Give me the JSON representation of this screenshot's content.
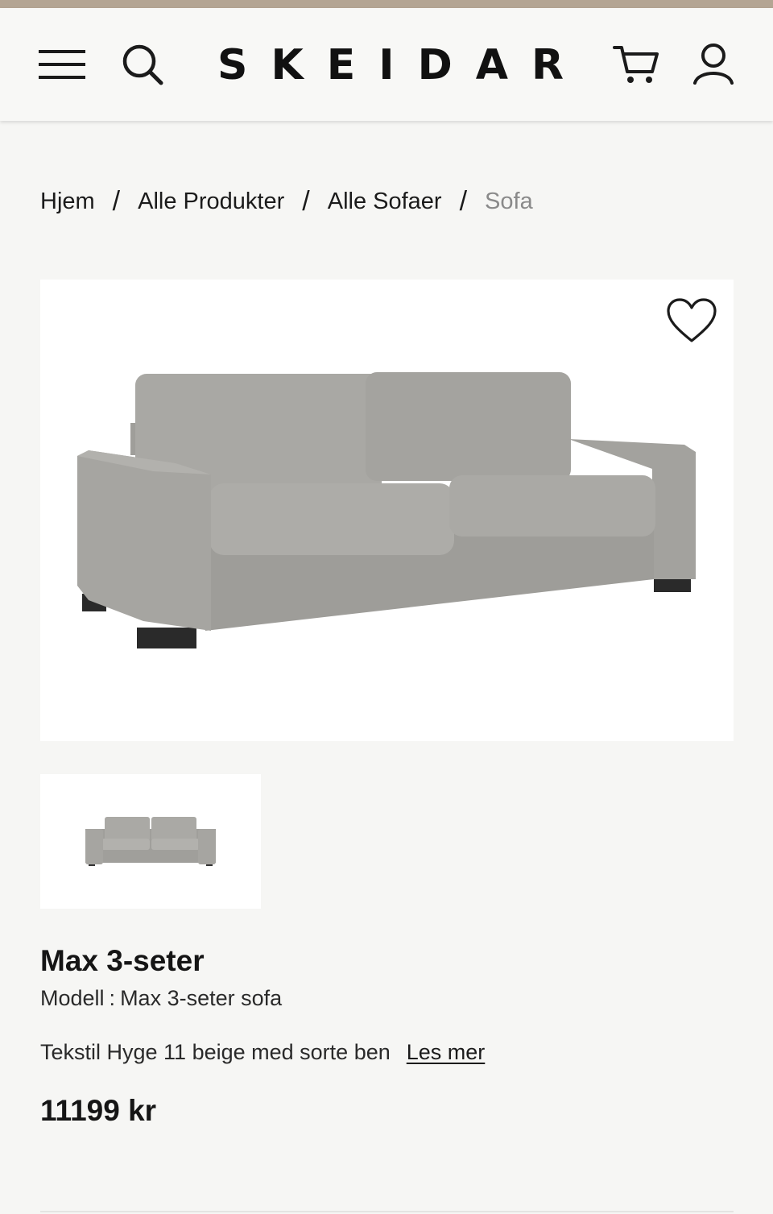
{
  "header": {
    "brand": "SKEIDAR",
    "menu_icon": "hamburger-menu-icon",
    "search_icon": "search-icon",
    "cart_icon": "cart-icon",
    "account_icon": "user-icon"
  },
  "breadcrumb": [
    {
      "label": "Hjem"
    },
    {
      "label": "Alle Produkter"
    },
    {
      "label": "Alle Sofaer"
    },
    {
      "label": "Sofa"
    }
  ],
  "product": {
    "title": "Max 3-seter",
    "model_label": "Modell",
    "model_separator": ":",
    "model_value": "Max 3-seter sofa",
    "description": "Tekstil Hyge 11 beige med sorte ben",
    "read_more": "Les mer",
    "price": "11199 kr"
  },
  "colors": {
    "accent_strip": "#b4a593",
    "background": "#f6f6f4",
    "sofa_fabric": "#a9a8a4",
    "sofa_legs": "#2a2a2a"
  }
}
